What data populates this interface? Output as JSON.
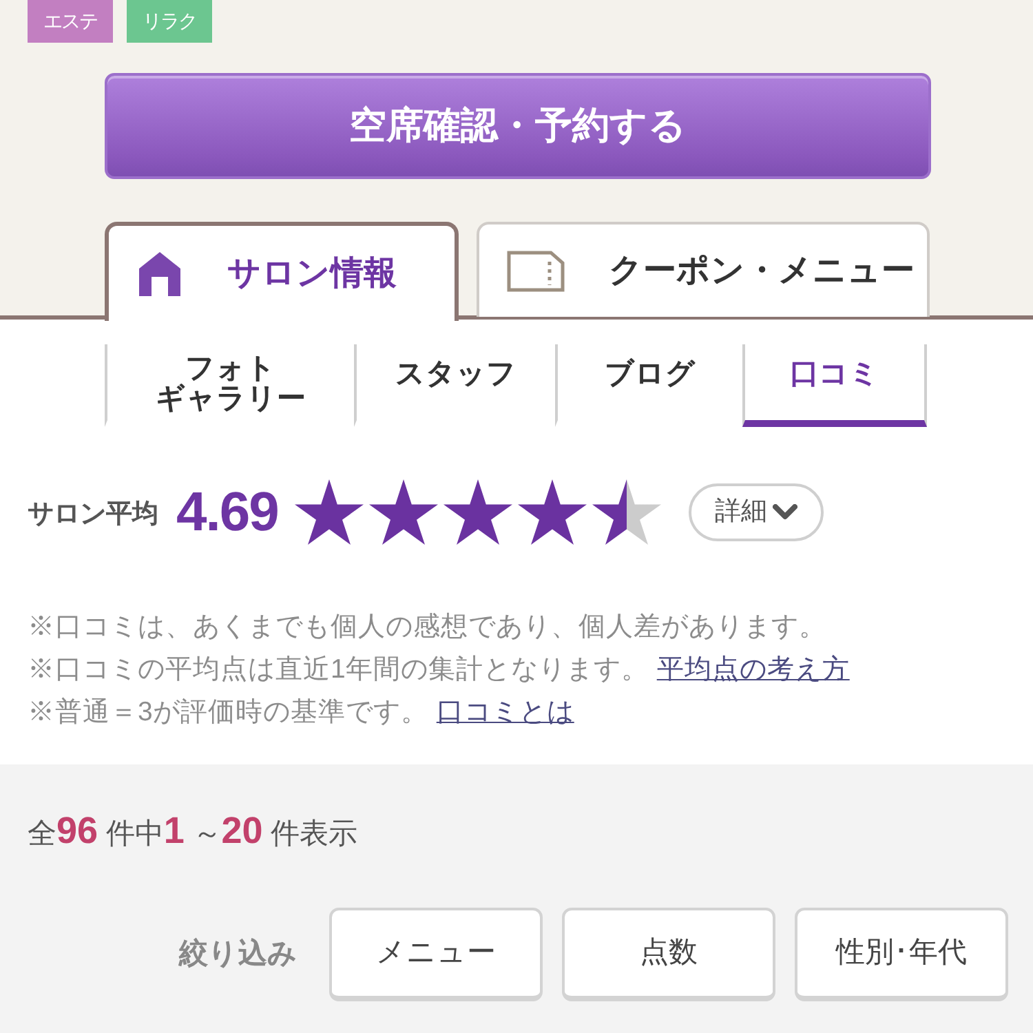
{
  "tags": [
    {
      "label": "エステ",
      "color": "#c27fc1"
    },
    {
      "label": "リラク",
      "color": "#6cc690"
    }
  ],
  "reserve_button": {
    "label": "空席確認・予約する"
  },
  "tabs": [
    {
      "label": "サロン情報",
      "selected": true,
      "kind": "house"
    },
    {
      "label": "クーポン・メニュー",
      "selected": false,
      "kind": "ticket"
    }
  ],
  "subnav": [
    {
      "lines": [
        "フォト",
        "ギャラリー"
      ],
      "selected": false
    },
    {
      "lines": [
        "スタッフ"
      ],
      "selected": false
    },
    {
      "lines": [
        "ブログ"
      ],
      "selected": false
    },
    {
      "lines": [
        "口コミ"
      ],
      "selected": true
    }
  ],
  "rating": {
    "label": "サロン平均",
    "score": "4.69",
    "stars": 4.5,
    "details_button": "詳細"
  },
  "notes": [
    {
      "text": "※口コミは、あくまでも個人の感想であり、個人差があります。"
    },
    {
      "text": "※口コミの平均点は直近1年間の集計となります。",
      "link": "平均点の考え方"
    },
    {
      "text": "※普通＝3が評価時の基準です。",
      "link": "口コミとは"
    }
  ],
  "result_count": "全**96** 件中**1** ～**20** 件表示",
  "filter": {
    "label": "絞り込み",
    "buttons": [
      "メニュー",
      "点数",
      "性別･年代"
    ]
  }
}
